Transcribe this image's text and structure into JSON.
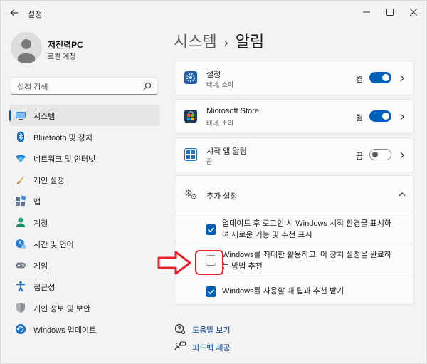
{
  "window": {
    "title": "설정"
  },
  "profile": {
    "name": "저전력PC",
    "account": "로컬 계정"
  },
  "search": {
    "placeholder": "설정 검색"
  },
  "sidebar": {
    "items": [
      {
        "label": "시스템",
        "icon": "system-icon",
        "active": true
      },
      {
        "label": "Bluetooth 및 장치",
        "icon": "bluetooth-icon"
      },
      {
        "label": "네트워크 및 인터넷",
        "icon": "wifi-icon"
      },
      {
        "label": "개인 설정",
        "icon": "brush-icon"
      },
      {
        "label": "앱",
        "icon": "apps-icon"
      },
      {
        "label": "계정",
        "icon": "account-icon"
      },
      {
        "label": "시간 및 언어",
        "icon": "clock-globe-icon"
      },
      {
        "label": "게임",
        "icon": "gamepad-icon"
      },
      {
        "label": "접근성",
        "icon": "accessibility-icon"
      },
      {
        "label": "개인 정보 및 보안",
        "icon": "shield-icon"
      },
      {
        "label": "Windows 업데이트",
        "icon": "windows-update-icon"
      }
    ]
  },
  "breadcrumb": {
    "parent": "시스템",
    "separator": "›",
    "current": "알림"
  },
  "apps": [
    {
      "title": "설정",
      "subtitle": "배너, 소리",
      "state": "켬",
      "on": true,
      "icon": "settings-app-icon"
    },
    {
      "title": "Microsoft Store",
      "subtitle": "배너, 소리",
      "state": "켬",
      "on": true,
      "icon": "store-app-icon"
    },
    {
      "title": "시작 앱 알림",
      "subtitle": "끔",
      "state": "끔",
      "on": false,
      "icon": "start-app-icon"
    }
  ],
  "extra": {
    "title": "추가 설정",
    "options": [
      {
        "text": "업데이트 후 로그인 시 Windows 시작 환경을 표시하여 새로운 기능 및 추천 표시",
        "checked": true
      },
      {
        "text": "Windows를 최대한 활용하고, 이 장치 설정을 완료하는 방법 추천",
        "checked": false
      },
      {
        "text": "Windows를 사용할 때 팁과 추천 받기",
        "checked": true
      }
    ]
  },
  "links": {
    "help": "도움말 보기",
    "feedback": "피드백 제공"
  },
  "colors": {
    "accent": "#005fb8",
    "annotation": "#e8212b"
  }
}
